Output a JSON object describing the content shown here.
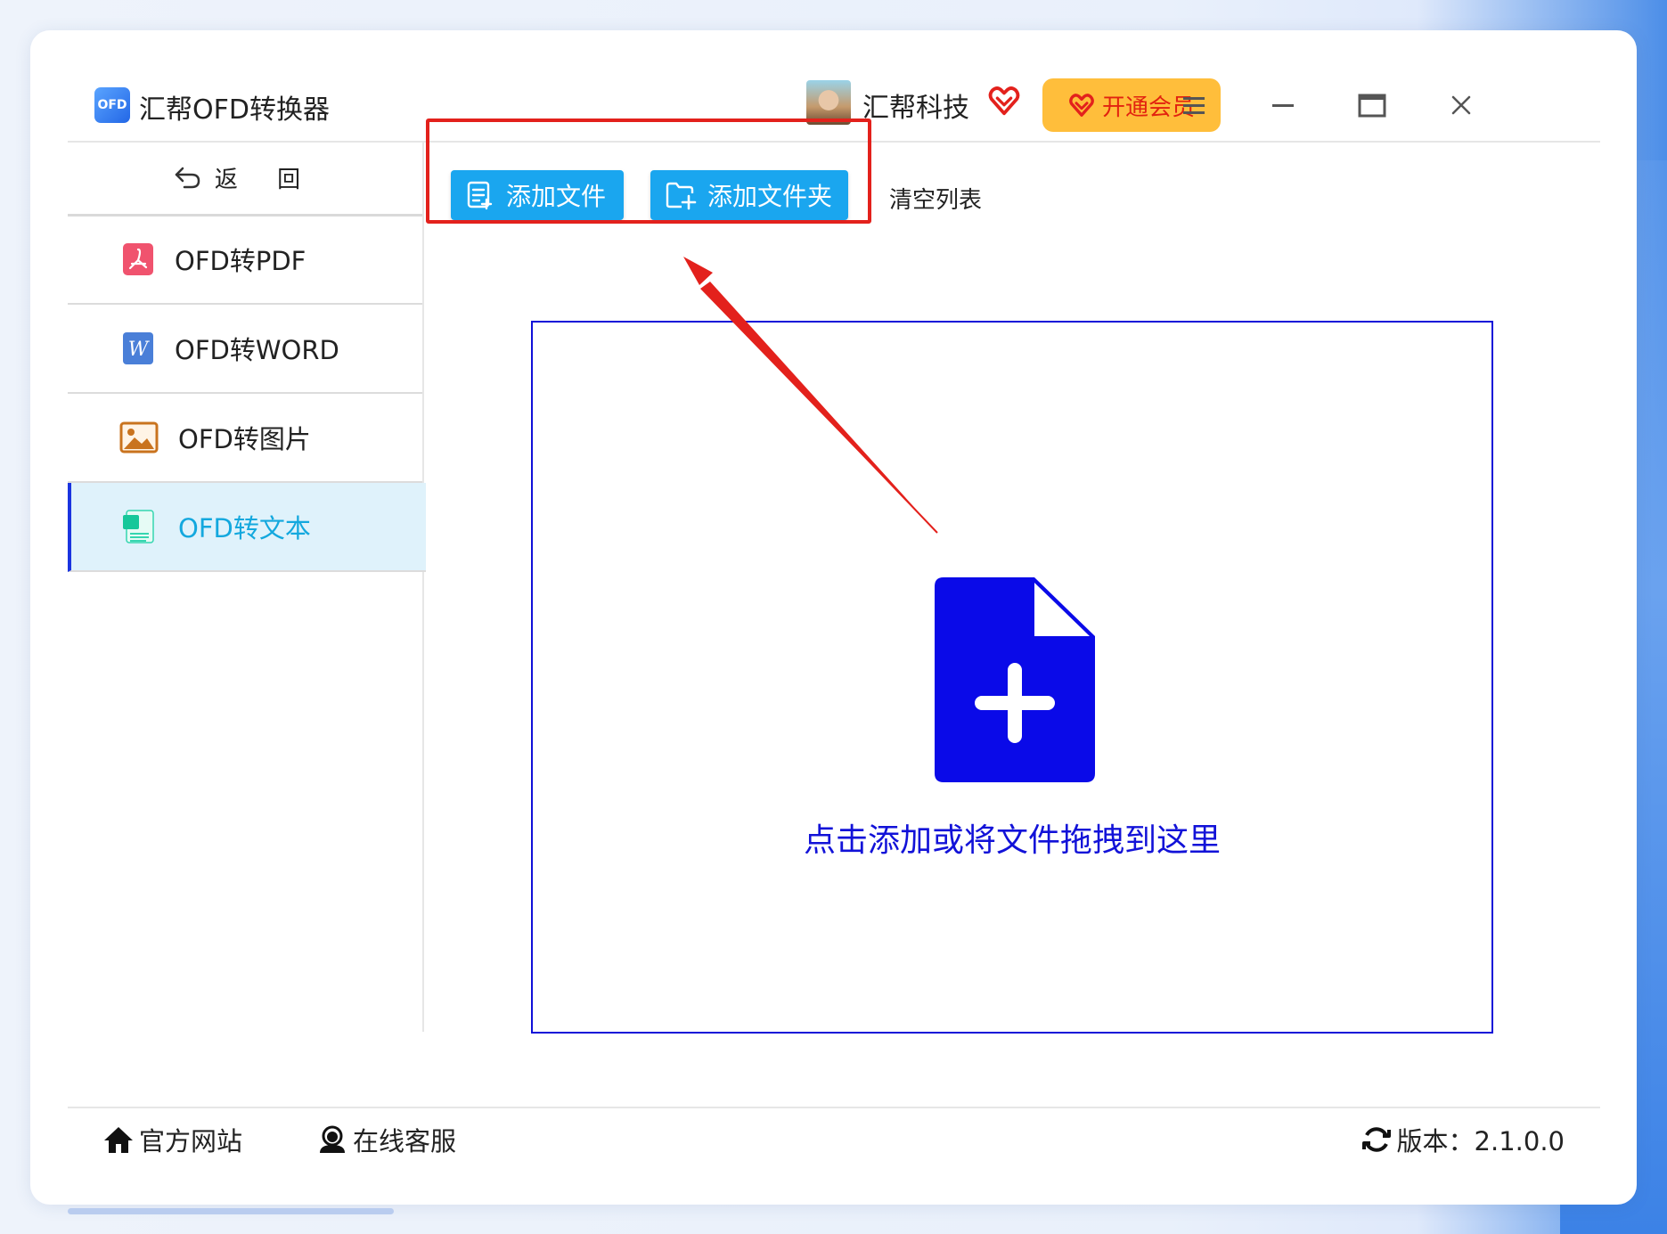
{
  "app": {
    "title": "汇帮OFD转换器",
    "logo_text": "OFD"
  },
  "header": {
    "user_name": "汇帮科技",
    "vip_label": "开通会员"
  },
  "sidebar": {
    "back_label": "返 回",
    "items": [
      {
        "label": "OFD转PDF",
        "icon": "pdf-icon",
        "active": false
      },
      {
        "label": "OFD转WORD",
        "icon": "word-icon",
        "active": false
      },
      {
        "label": "OFD转图片",
        "icon": "image-icon",
        "active": false
      },
      {
        "label": "OFD转文本",
        "icon": "text-file-icon",
        "active": true
      }
    ]
  },
  "toolbar": {
    "add_file_label": "添加文件",
    "add_folder_label": "添加文件夹",
    "clear_list_label": "清空列表"
  },
  "dropzone": {
    "hint": "点击添加或将文件拖拽到这里"
  },
  "footer": {
    "website_label": "官方网站",
    "support_label": "在线客服",
    "version_label": "版本：2.1.0.0"
  },
  "colors": {
    "accent_blue": "#1aa6ef",
    "dropzone_blue": "#0a0ae8",
    "vip_yellow": "#ffbe3b",
    "annotation_red": "#e3211c",
    "active_nav_text": "#13a8de"
  }
}
